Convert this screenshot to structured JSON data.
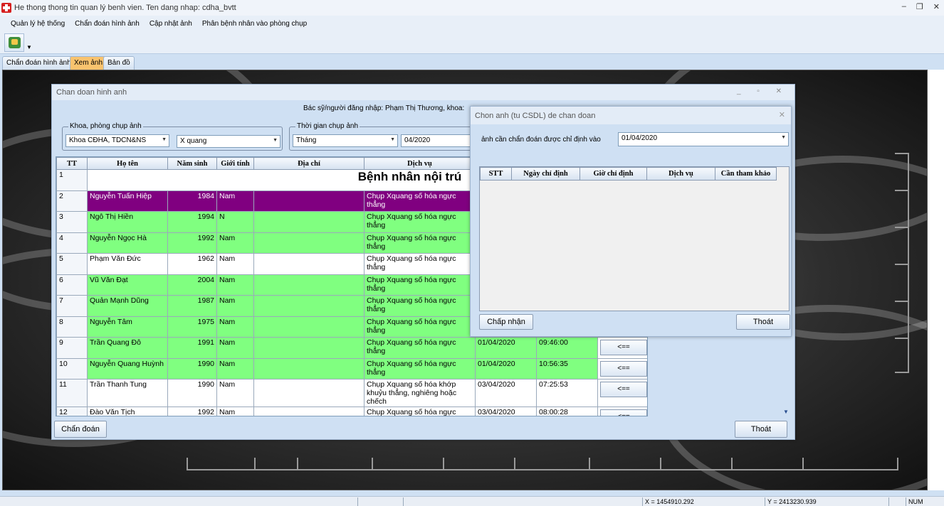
{
  "window": {
    "title": "He thong thong tin quan lý benh vien. Ten dang nhap: cdha_bvtt",
    "minimize": "–",
    "restore": "❐",
    "close": "✕"
  },
  "menu": [
    "Quản lý hệ thống",
    "Chẩn đoán hình ảnh",
    "Cập nhật ảnh",
    "Phân bệnh nhân vào phòng chụp"
  ],
  "tabs": [
    "Chẩn đoán hình ảnh",
    "Xem ảnh",
    "Bản đồ"
  ],
  "active_tab": "Xem ảnh",
  "statusbar": {
    "x": "X = 1454910.292",
    "y": "Y = 2413230.939",
    "num": "NUM"
  },
  "dialog": {
    "title": "Chan doan hinh anh",
    "doctor_line": "Bác sỹ/người đăng nhập: Phạm Thị Thương, khoa: ",
    "group_department": {
      "label": "Khoa, phòng chụp ảnh",
      "department": "Khoa CĐHA, TDCN&NS",
      "modality": "X quang"
    },
    "group_time": {
      "label": "Thời gian chụp ảnh",
      "period": "Tháng",
      "value": "04/2020"
    },
    "columns": [
      "TT",
      "Họ tên",
      "Năm sinh",
      "Giới tính",
      "Địa chỉ",
      "Dịch vụ"
    ],
    "section_title": "Bệnh nhân nội trú",
    "rows": [
      {
        "tt": "2",
        "name": "Nguyễn Tuấn Hiệp",
        "year": "1984",
        "sex": "Nam",
        "address": "",
        "service": "Chụp Xquang số hóa ngực thẳng",
        "date": "",
        "time": "",
        "style": "purple"
      },
      {
        "tt": "3",
        "name": "Ngô Thị Hiền",
        "year": "1994",
        "sex": "N",
        "address": "",
        "service": "Chụp Xquang số hóa ngực thẳng",
        "date": "",
        "time": "",
        "style": "green"
      },
      {
        "tt": "4",
        "name": "Nguyễn Ngọc Hà",
        "year": "1992",
        "sex": "Nam",
        "address": "",
        "service": "Chụp Xquang số hóa ngực thẳng",
        "date": "",
        "time": "",
        "style": "green"
      },
      {
        "tt": "5",
        "name": "Phạm Văn Đức",
        "year": "1962",
        "sex": "Nam",
        "address": "",
        "service": "Chụp Xquang số hóa ngực thẳng",
        "date": "",
        "time": "",
        "style": "white"
      },
      {
        "tt": "6",
        "name": "Vũ Văn Đạt",
        "year": "2004",
        "sex": "Nam",
        "address": "",
        "service": "Chụp Xquang số hóa ngực thẳng",
        "date": "",
        "time": "",
        "style": "green"
      },
      {
        "tt": "7",
        "name": "Quản Mạnh Dũng",
        "year": "1987",
        "sex": "Nam",
        "address": "",
        "service": "Chụp Xquang số hóa ngực thẳng",
        "date": "",
        "time": "",
        "style": "green"
      },
      {
        "tt": "8",
        "name": "Nguyễn Tâm",
        "year": "1975",
        "sex": "Nam",
        "address": "",
        "service": "Chụp Xquang số hóa ngực thẳng",
        "date": "",
        "time": "",
        "style": "green"
      },
      {
        "tt": "9",
        "name": "Trần Quang Đô",
        "year": "1991",
        "sex": "Nam",
        "address": "",
        "service": "Chụp Xquang số hóa ngực thẳng",
        "date": "01/04/2020",
        "time": "09:46:00",
        "style": "green"
      },
      {
        "tt": "10",
        "name": "Nguyễn Quang Huỳnh",
        "year": "1990",
        "sex": "Nam",
        "address": "",
        "service": "Chụp Xquang số hóa ngực thẳng",
        "date": "01/04/2020",
        "time": "10:56:35",
        "style": "green"
      },
      {
        "tt": "11",
        "name": "Trần Thanh Tung",
        "year": "1990",
        "sex": "Nam",
        "address": "",
        "service": "Chụp Xquang số hóa khớp khuỷu thẳng, nghiêng hoặc chếch",
        "date": "03/04/2020",
        "time": "07:25:53",
        "style": "white"
      },
      {
        "tt": "12",
        "name": "Đào Văn Tịch",
        "year": "1992",
        "sex": "Nam",
        "address": "",
        "service": "Chụp Xquang số hóa ngực",
        "date": "03/04/2020",
        "time": "08:00:28",
        "style": "white"
      }
    ],
    "row_button": "<==",
    "diagnose_button": "Chẩn đoán",
    "exit_button": "Thoát"
  },
  "subdialog": {
    "title": "Chon anh (tu CSDL) de chan doan",
    "label": "ảnh cần chẩn đoán được chỉ định vào",
    "date": "01/04/2020",
    "columns": [
      "STT",
      "Ngày chỉ định",
      "Giờ chỉ định",
      "Dịch vụ",
      "Cần tham khảo"
    ],
    "accept_button": "Chấp nhận",
    "exit_button": "Thoát"
  }
}
